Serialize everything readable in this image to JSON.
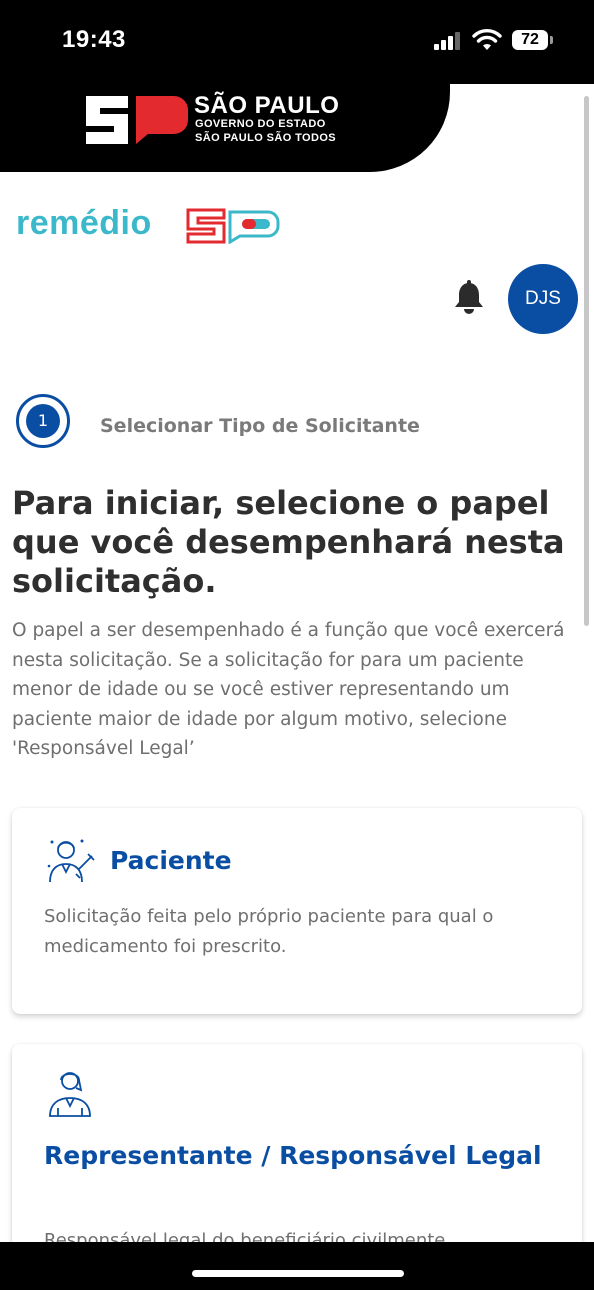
{
  "status_bar": {
    "time": "19:43",
    "battery": "72"
  },
  "gov_banner": {
    "title": "SÃO PAULO",
    "subtitle1": "GOVERNO DO ESTADO",
    "subtitle2": "SÃO PAULO SÃO TODOS"
  },
  "brand": {
    "name": "remédio"
  },
  "header": {
    "avatar_initials": "DJS"
  },
  "step": {
    "number": "1",
    "label": "Selecionar Tipo de Solicitante"
  },
  "heading": "Para iniciar, selecione o papel que você desempenhará nesta solicitação.",
  "description": "O papel a ser desempenhado é a função que você exercerá nesta solicitação. Se a solicitação for para um paciente menor de idade ou se você estiver representando um paciente maior de idade por algum motivo, selecione 'Responsável Legal’",
  "cards": [
    {
      "title": "Paciente",
      "text": "Solicitação feita pelo próprio paciente para qual o medicamento foi prescrito.",
      "icon": "patient-icon"
    },
    {
      "title": "Representante / Responsável Legal",
      "text": "Responsável legal do beneficiário civilmente",
      "icon": "representative-icon"
    }
  ],
  "colors": {
    "primary": "#0a4ea3",
    "brand_teal": "#3bb8c9",
    "brand_red": "#e32a2f"
  }
}
